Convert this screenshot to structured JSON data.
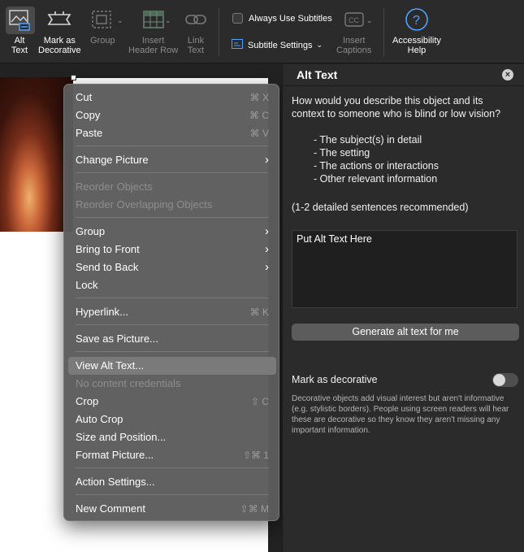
{
  "ribbon": {
    "alt_text": "Alt\nText",
    "mark_decorative": "Mark as\nDecorative",
    "group": "Group",
    "insert_header_row": "Insert\nHeader Row",
    "link_text": "Link\nText",
    "always_use_subtitles": "Always Use Subtitles",
    "subtitle_settings": "Subtitle Settings",
    "insert_captions": "Insert\nCaptions",
    "accessibility_help": "Accessibility\nHelp"
  },
  "context_menu": {
    "cut": "Cut",
    "cut_sc": "⌘ X",
    "copy": "Copy",
    "copy_sc": "⌘ C",
    "paste": "Paste",
    "paste_sc": "⌘ V",
    "change_picture": "Change Picture",
    "reorder_objects": "Reorder Objects",
    "reorder_overlapping": "Reorder Overlapping Objects",
    "group": "Group",
    "bring_to_front": "Bring to Front",
    "send_to_back": "Send to Back",
    "lock": "Lock",
    "hyperlink": "Hyperlink...",
    "hyperlink_sc": "⌘ K",
    "save_as_picture": "Save as Picture...",
    "view_alt_text": "View Alt Text...",
    "no_content_credentials": "No content credentials",
    "crop": "Crop",
    "crop_sc": "⇧ C",
    "auto_crop": "Auto Crop",
    "size_and_position": "Size and Position...",
    "format_picture": "Format Picture...",
    "format_picture_sc": "⇧⌘ 1",
    "action_settings": "Action Settings...",
    "new_comment": "New Comment",
    "new_comment_sc": "⇧⌘ M"
  },
  "pane": {
    "title": "Alt Text",
    "prompt": "How would you describe this object and its context to someone who is blind or low vision?",
    "bullets": [
      "- The subject(s) in detail",
      "- The setting",
      "- The actions or interactions",
      "- Other relevant information"
    ],
    "recommendation": "(1-2 detailed sentences recommended)",
    "textarea_value": "Put Alt Text Here",
    "generate_button": "Generate alt text for me",
    "mark_decorative_label": "Mark as decorative",
    "decorative_description": "Decorative objects add visual interest but aren't informative (e.g. stylistic borders). People using screen readers will hear these are decorative so they know they aren't missing any important information."
  }
}
